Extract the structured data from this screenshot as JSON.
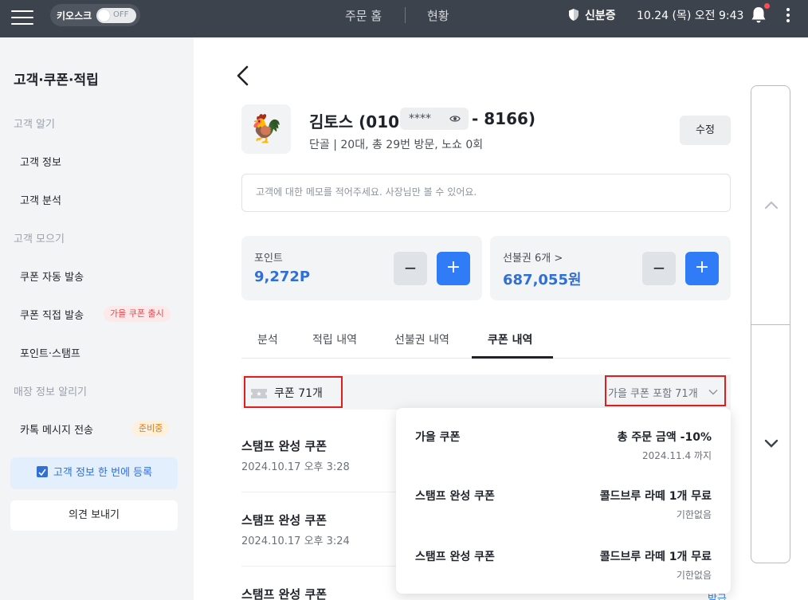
{
  "topbar": {
    "kiosk_label": "키오스크",
    "kiosk_state": "OFF",
    "nav": [
      "주문 홈",
      "현황"
    ],
    "id_check": "신분증",
    "datetime": "10.24 (목) 오전 9:43",
    "icons": [
      "menu-icon",
      "shield-icon",
      "bell-icon",
      "more-icon"
    ]
  },
  "sidebar": {
    "title": "고객·쿠폰·적립",
    "sections": [
      {
        "label": "고객 알기",
        "items": [
          "고객 정보",
          "고객 분석"
        ]
      },
      {
        "label": "고객 모으기",
        "items": [
          "쿠폰 자동 발송",
          "쿠폰 직접 발송",
          "포인트·스탬프"
        ]
      },
      {
        "label": "매장 정보 알리기",
        "items": [
          "카톡 메시지 전송"
        ]
      }
    ],
    "badge_coupon": "가을 쿠폰 출시",
    "badge_kakao": "준비중",
    "register_button": "고객 정보 한 번에 등록",
    "feedback_button": "의견 보내기"
  },
  "customer": {
    "avatar": "🐓",
    "name_prefix": "김토스 (010 -",
    "masked": "****",
    "phone_tail": "- 8166)",
    "summary": "단골 | 20대, 총 29번 방문, 노쇼 0회",
    "edit_label": "수정",
    "memo_placeholder": "고객에 대한 메모를 적어주세요. 사장님만 볼 수 있어요."
  },
  "cards": {
    "points_label": "포인트",
    "points_value": "9,272P",
    "prepaid_label": "선불권 6개 >",
    "prepaid_value": "687,055원",
    "minus": "−",
    "plus": "+"
  },
  "tabs": [
    "분석",
    "적립 내역",
    "선불권 내역",
    "쿠폰 내역"
  ],
  "active_tab": "쿠폰 내역",
  "coupons": {
    "count_label": "쿠폰 71개",
    "filter_label": "가을 쿠폰 포함 71개",
    "list": [
      {
        "title": "스탬프 완성 쿠폰",
        "date": "2024.10.17 오후 3:28"
      },
      {
        "title": "스탬프 완성 쿠폰",
        "date": "2024.10.17 오후 3:24"
      },
      {
        "title": "스탬프 완성 쿠폰",
        "date": ""
      }
    ],
    "cutoff_text": "발급"
  },
  "dropdown": [
    {
      "name": "가을 쿠폰",
      "benefit": "총 주문 금액 -10%",
      "expiry": "2024.11.4 까지"
    },
    {
      "name": "스탬프 완성 쿠폰",
      "benefit": "콜드브루 라떼 1개 무료",
      "expiry": "기한없음"
    },
    {
      "name": "스탬프 완성 쿠폰",
      "benefit": "콜드브루 라떼 1개 무료",
      "expiry": "기한없음"
    }
  ],
  "colors": {
    "topbar": "#3c434c",
    "accent_blue": "#2f7cf6",
    "highlight_red": "#e01e1e"
  }
}
